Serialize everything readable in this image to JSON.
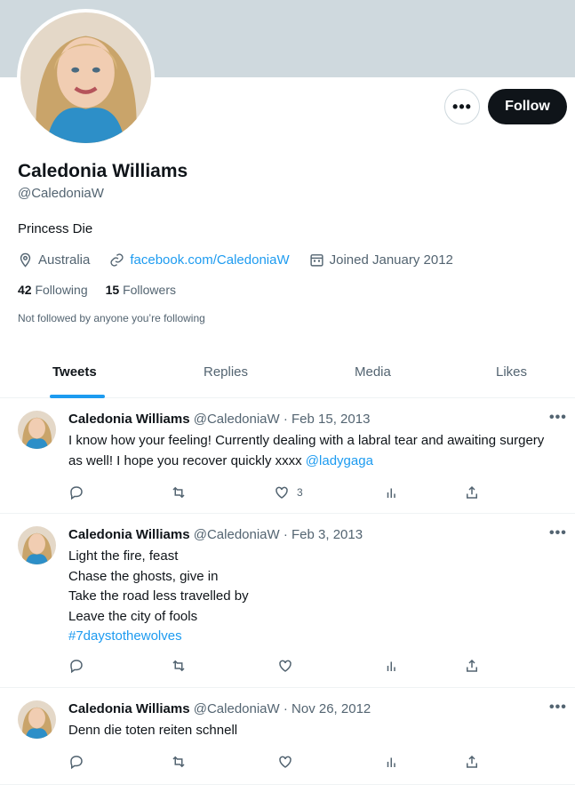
{
  "profile": {
    "name": "Caledonia Williams",
    "handle": "@CaledoniaW",
    "bio": "Princess Die",
    "location": "Australia",
    "website": "facebook.com/CaledoniaW",
    "joined": "Joined January 2012",
    "following_count": "42",
    "following_label": "Following",
    "followers_count": "15",
    "followers_label": "Followers",
    "not_followed_text": "Not followed by anyone you’re following"
  },
  "buttons": {
    "more": "•••",
    "follow": "Follow"
  },
  "tabs": [
    "Tweets",
    "Replies",
    "Media",
    "Likes"
  ],
  "active_tab": "Tweets",
  "tweets": [
    {
      "name": "Caledonia Williams",
      "meta": "@CaledoniaW · Feb 15, 2013",
      "text": "I know how your feeling! Currently dealing with a labral tear and awaiting surgery as well! I hope you recover quickly xxxx",
      "mention": "@ladygaga",
      "likes": "3"
    },
    {
      "name": "Caledonia Williams",
      "meta": "@CaledoniaW · Feb 3, 2013",
      "lines": [
        "Light the fire, feast",
        "Chase the ghosts, give in",
        "Take the road less travelled by",
        "Leave the city of fools"
      ],
      "hashtag": "#7daystothewolves",
      "likes": ""
    },
    {
      "name": "Caledonia Williams",
      "meta": "@CaledoniaW · Nov 26, 2012",
      "text": "Denn die toten reiten schnell",
      "likes": ""
    }
  ],
  "colors": {
    "accent": "#1d9bf0",
    "banner": "#cfd9de",
    "text": "#0f1419",
    "muted": "#536471"
  }
}
